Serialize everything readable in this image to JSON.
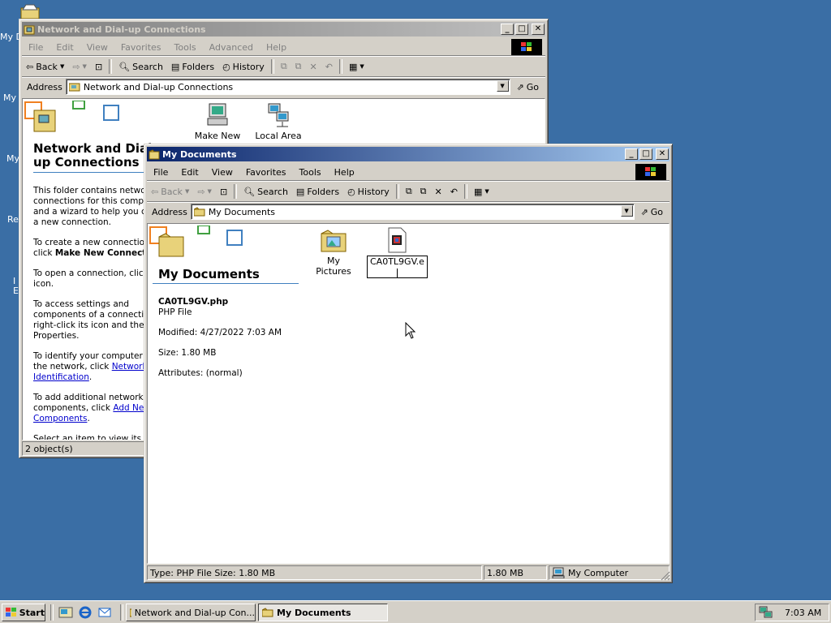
{
  "desktop": {
    "labels": [
      "My D",
      "My",
      "My",
      "Re",
      "I",
      "E"
    ]
  },
  "win_back": {
    "title": "Network and Dial-up Connections",
    "menu": [
      "File",
      "Edit",
      "View",
      "Favorites",
      "Tools",
      "Advanced",
      "Help"
    ],
    "toolbar": {
      "back": "Back",
      "search": "Search",
      "folders": "Folders",
      "history": "History"
    },
    "address_label": "Address",
    "address_value": "Network and Dial-up Connections",
    "go": "Go",
    "panel_title": "Network and Dial-up Connections",
    "panel_title_visible": "Network and Dial-\nup Connections",
    "para1": "This folder contains network connections for this computer, and a wizard to help you create a new connection.",
    "para2_a": "To create a new connection, click",
    "para2_b": "Make New Connection",
    "para3": "To open a connection, click its icon.",
    "para4": "To access settings and components of a connection, right-click its icon and then click Properties.",
    "para5_a": "To identify your computer on the network, click",
    "para5_link": "Network Identification",
    "para6_a": "To add additional networking components, click",
    "para6_link": "Add Network Components",
    "para7": "Select an item to view its description.",
    "icons": [
      {
        "label": "Make New"
      },
      {
        "label": "Local Area"
      }
    ],
    "status": "2 object(s)"
  },
  "win_front": {
    "title": "My Documents",
    "menu": [
      "File",
      "Edit",
      "View",
      "Favorites",
      "Tools",
      "Help"
    ],
    "toolbar": {
      "back": "Back",
      "search": "Search",
      "folders": "Folders",
      "history": "History"
    },
    "address_label": "Address",
    "address_value": "My Documents",
    "go": "Go",
    "panel_title": "My Documents",
    "file_name": "CA0TL9GV.php",
    "file_type": "PHP File",
    "modified": "Modified: 4/27/2022 7:03 AM",
    "size": "Size: 1.80 MB",
    "attributes": "Attributes: (normal)",
    "icons": [
      {
        "label": "My Pictures"
      },
      {
        "label": "CA0TL9GV.e"
      }
    ],
    "status": {
      "left": "Type: PHP File Size: 1.80 MB",
      "size": "1.80 MB",
      "zone": "My Computer"
    }
  },
  "taskbar": {
    "start": "Start",
    "tasks": [
      "Network and Dial-up Con...",
      "My Documents"
    ],
    "clock": "7:03 AM"
  },
  "colors": {
    "desktop": "#3a6ea5",
    "active_title": "#0a246a",
    "face": "#d4d0c8"
  }
}
